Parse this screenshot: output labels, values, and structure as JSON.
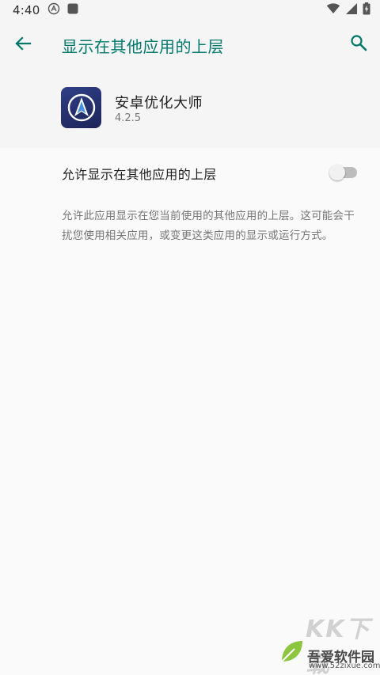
{
  "status_bar": {
    "time": "4:40"
  },
  "app_bar": {
    "title": "显示在其他应用的上层"
  },
  "app_info": {
    "name": "安卓优化大师",
    "version": "4.2.5"
  },
  "setting": {
    "label": "允许显示在其他应用的上层",
    "enabled": false
  },
  "description": "允许此应用显示在您当前使用的其他应用的上层。这可能会干扰您使用相关应用，或变更这类应用的显示或运行方式。",
  "watermark": {
    "big_text": "KK下载",
    "name": "吾爱软件园",
    "url": "www.52zixue.com"
  },
  "colors": {
    "accent": "#00796b",
    "background": "#fafafa",
    "header_background": "#f5f5f5",
    "switch_track_off": "#bdbdbd",
    "switch_thumb_off": "#f1f1f1"
  }
}
